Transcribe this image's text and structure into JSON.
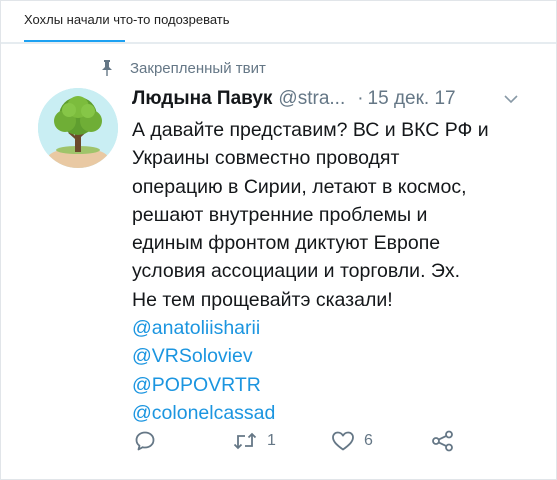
{
  "caption": "Хохлы начали что-то подозревать",
  "tweet": {
    "pinned_label": "Закрепленный твит",
    "author_name": "Людына Павук",
    "author_handle": "@stra...",
    "separator": "·",
    "date": "15 дек. 17",
    "text_lines": [
      "А давайте представим? ВС и ВКС РФ и",
      "Украины совместно проводят",
      "операцию в Сирии, летают в космос,",
      "решают внутренние проблемы и",
      "единым фронтом диктуют Европе",
      "условия ассоциации и торговли. Эх.",
      "Не тем прощевайтэ сказали!"
    ],
    "mentions": [
      "@anatoliisharii",
      "@VRSoloviev",
      "@POPOVRTR",
      "@colonelcassad"
    ],
    "retweet_count": "1",
    "like_count": "6"
  },
  "icons": {
    "pin": "pin-icon",
    "menu": "chevron-down-icon",
    "reply": "reply-icon",
    "retweet": "retweet-icon",
    "like": "heart-icon",
    "share": "share-icon"
  },
  "colors": {
    "accent": "#1da1f2",
    "link": "#1b95e0",
    "text": "#14171a",
    "muted": "#657786"
  }
}
